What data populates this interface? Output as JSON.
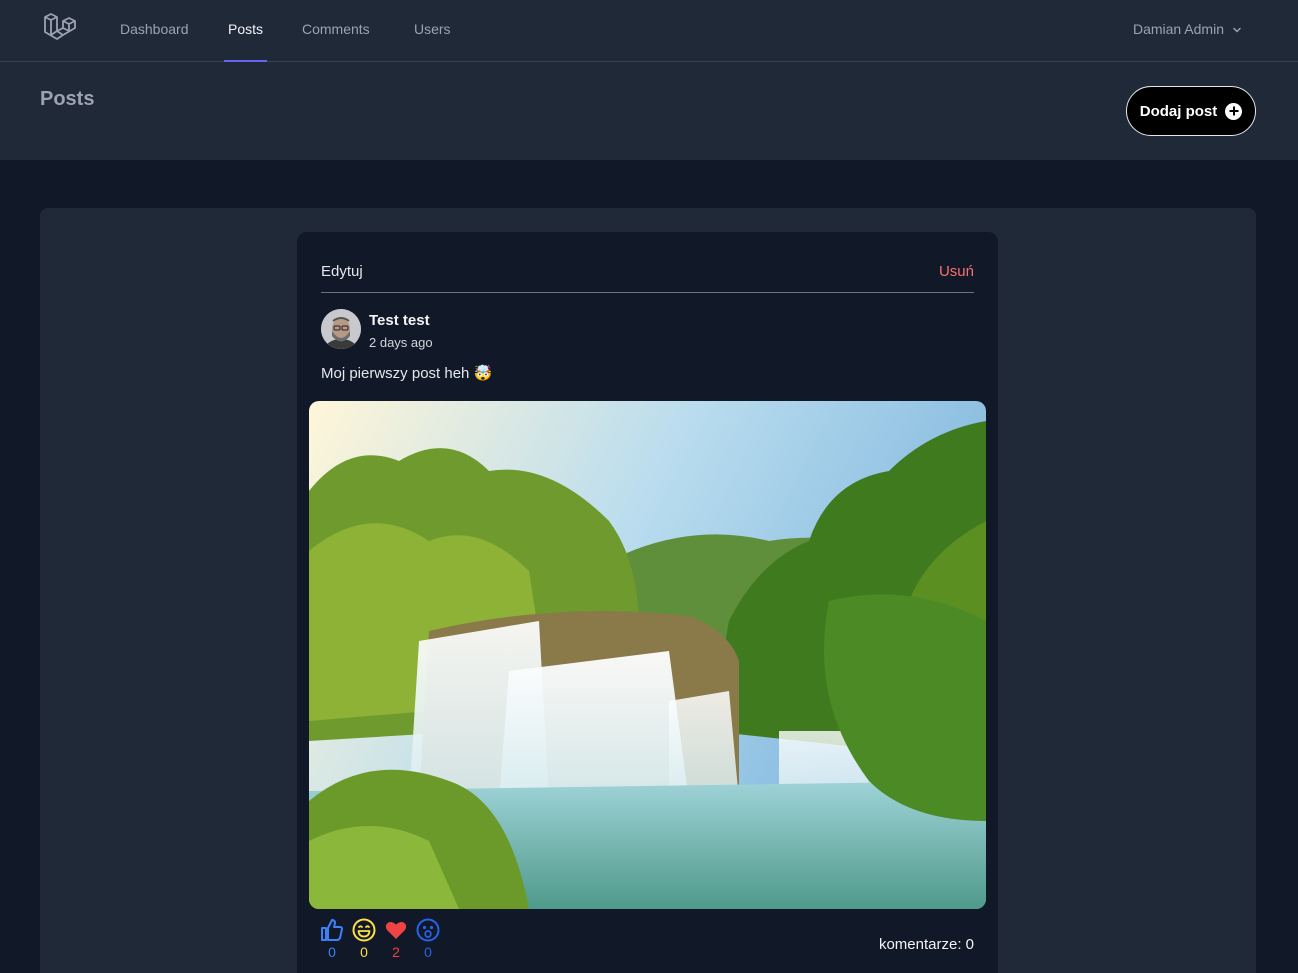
{
  "nav": {
    "items": [
      {
        "label": "Dashboard",
        "active": false
      },
      {
        "label": "Posts",
        "active": true
      },
      {
        "label": "Comments",
        "active": false
      },
      {
        "label": "Users",
        "active": false
      }
    ],
    "user_name": "Damian Admin"
  },
  "header": {
    "title": "Posts",
    "add_button_label": "Dodaj post"
  },
  "post": {
    "edit_label": "Edytuj",
    "delete_label": "Usuń",
    "author": "Test test",
    "time": "2 days ago",
    "content": "Moj pierwszy post heh 🤯",
    "reactions": [
      {
        "icon": "thumbs-up-icon",
        "count": "0",
        "color": "#3b82f6"
      },
      {
        "icon": "grin-icon",
        "count": "0",
        "color": "#fde047"
      },
      {
        "icon": "heart-icon",
        "count": "2",
        "color": "#ef4444"
      },
      {
        "icon": "surprised-icon",
        "count": "0",
        "color": "#2563eb"
      }
    ],
    "comments_label": "komentarze: 0"
  },
  "colors": {
    "accent": "#6366f1",
    "danger": "#f87171",
    "background": "#111827",
    "surface": "#1f2937"
  }
}
